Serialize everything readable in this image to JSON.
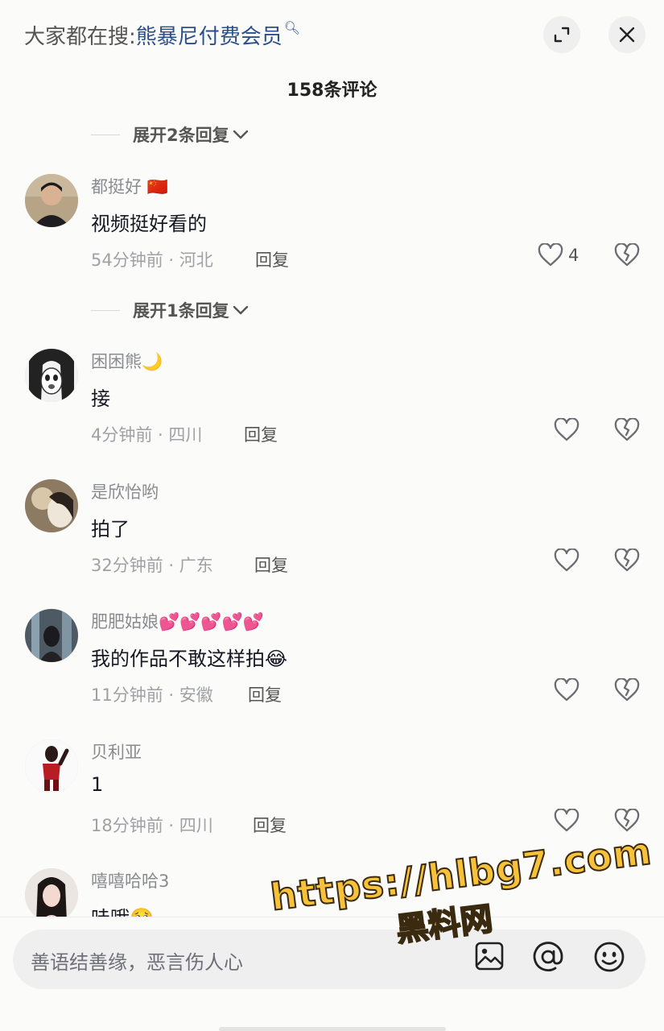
{
  "header": {
    "search_prefix": "大家都在搜:",
    "search_keyword": "熊暴尼付费会员",
    "comment_count": "158条评论"
  },
  "expand_replies": [
    {
      "label": "展开2条回复"
    },
    {
      "label": "展开1条回复"
    }
  ],
  "comments": [
    {
      "username": "都挺好",
      "badge": "🇨🇳",
      "text": "视频挺好看的",
      "time_location": "54分钟前 · 河北",
      "reply_label": "回复",
      "like_count": "4"
    },
    {
      "username": "困困熊",
      "badge": "🌙",
      "text": "接",
      "time_location": "4分钟前 · 四川",
      "reply_label": "回复",
      "like_count": ""
    },
    {
      "username": "是欣怡哟",
      "badge": "",
      "text": "拍了",
      "time_location": "32分钟前 · 广东",
      "reply_label": "回复",
      "like_count": ""
    },
    {
      "username": "肥肥姑娘",
      "badge": "💕💕💕💕💕",
      "text": "我的作品不敢这样拍😂",
      "time_location": "11分钟前 · 安徽",
      "reply_label": "回复",
      "like_count": ""
    },
    {
      "username": "贝利亚",
      "badge": "",
      "text": "1",
      "time_location": "18分钟前 · 四川",
      "reply_label": "回复",
      "like_count": ""
    },
    {
      "username": "嘻嘻哈哈3",
      "badge": "",
      "text": "哇哦🥺",
      "time_location": "",
      "reply_label": "",
      "like_count": ""
    }
  ],
  "input": {
    "placeholder": "善语结善缘，恶言伤人心"
  },
  "watermark": {
    "url": "https://hlbg7.com",
    "name": "黑料网"
  },
  "icons": {
    "search_suffix": "search-icon",
    "expand": "expand-icon",
    "close": "close-icon",
    "chevron": "chevron-down-icon",
    "like": "heart-icon",
    "dislike": "broken-heart-icon",
    "image": "image-icon",
    "mention": "at-icon",
    "emoji": "emoji-icon"
  }
}
